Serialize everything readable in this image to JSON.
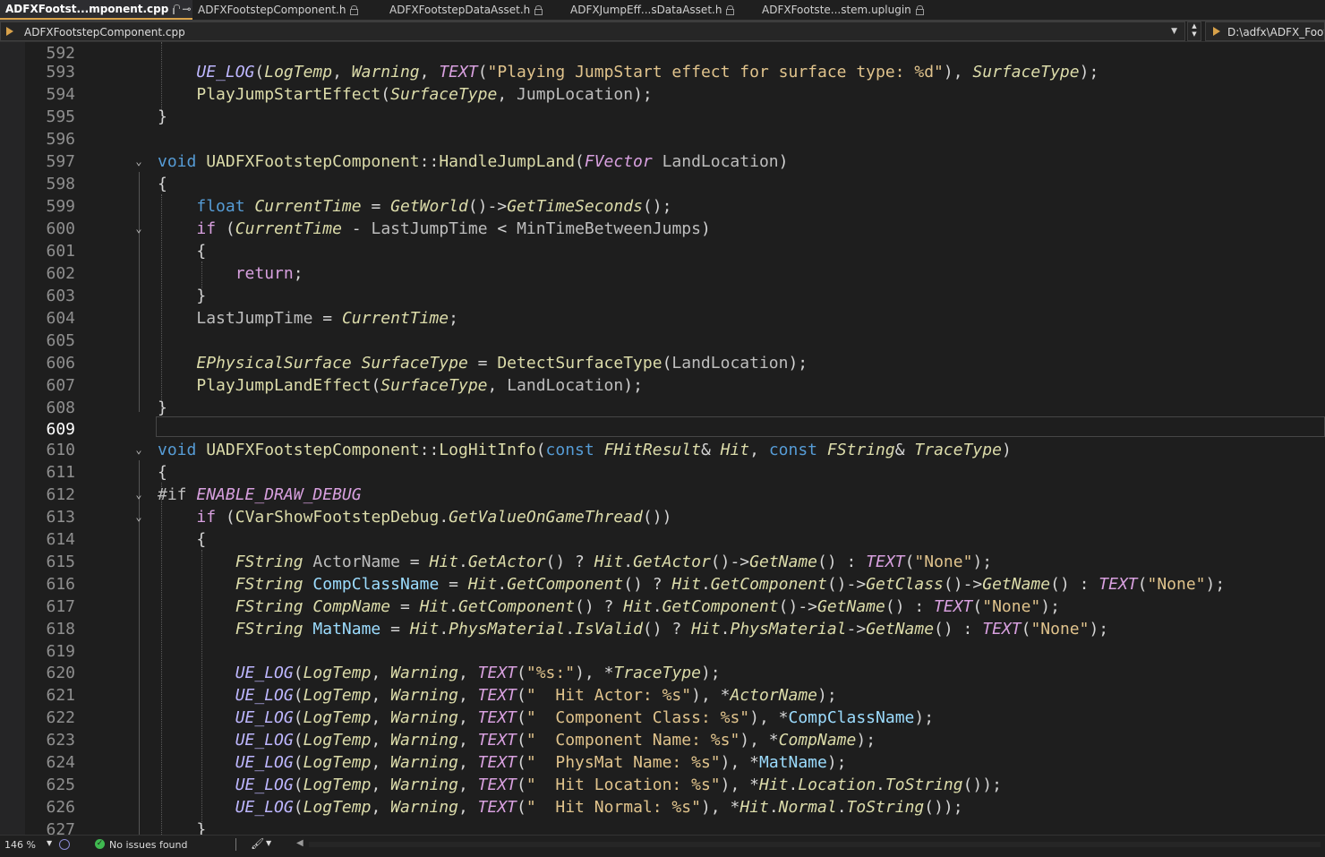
{
  "tabs": [
    {
      "label": "ADFXFootst...mponent.cpp",
      "active": true
    },
    {
      "label": "ADFXFootstepComponent.h",
      "active": false
    },
    {
      "label": "ADFXFootstepDataAsset.h",
      "active": false
    },
    {
      "label": "ADFXJumpEff...sDataAsset.h",
      "active": false
    },
    {
      "label": "ADFXFootste...stem.uplugin",
      "active": false
    }
  ],
  "navbar": {
    "file": "ADFXFootstepComponent.cpp",
    "path": "D:\\adfx\\ADFX_Footst"
  },
  "editor": {
    "current_line": "609",
    "line_numbers": [
      "592",
      "593",
      "594",
      "595",
      "596",
      "597",
      "598",
      "599",
      "600",
      "601",
      "602",
      "603",
      "604",
      "605",
      "606",
      "607",
      "608",
      "609",
      "610",
      "611",
      "612",
      "613",
      "614",
      "615",
      "616",
      "617",
      "618",
      "619",
      "620",
      "621",
      "622",
      "623",
      "624",
      "625",
      "626",
      "627"
    ]
  },
  "status": {
    "zoom": "146 %",
    "issues": "No issues found"
  },
  "colors": {
    "keyword": "#569cd6",
    "control": "#d8a0df",
    "function": "#dcdcaa",
    "string": "#e0c38c",
    "macro": "#beb7ff",
    "variable": "#9cdcfe",
    "accent": "#d7a14a"
  }
}
